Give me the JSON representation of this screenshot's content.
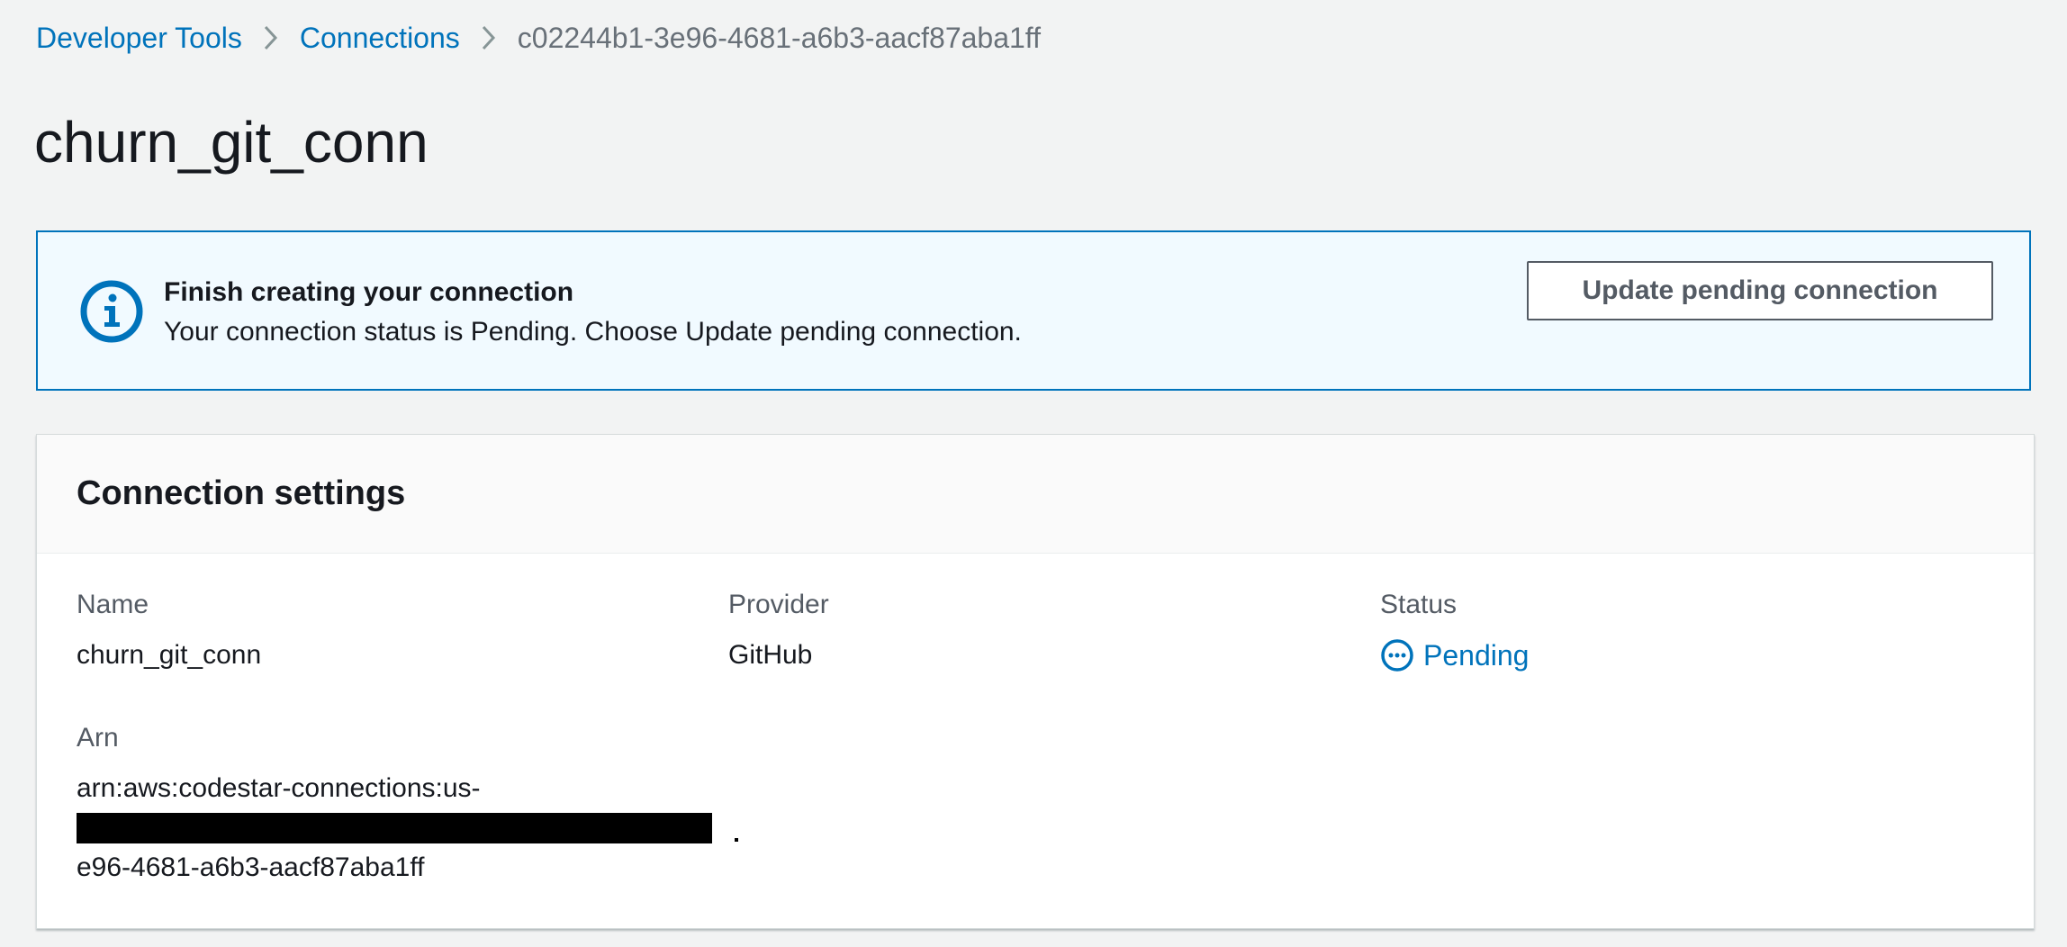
{
  "breadcrumb": {
    "items": [
      {
        "label": "Developer Tools"
      },
      {
        "label": "Connections"
      }
    ],
    "current": "c02244b1-3e96-4681-a6b3-aacf87aba1ff"
  },
  "page": {
    "title": "churn_git_conn"
  },
  "alert": {
    "icon": "info-icon",
    "title": "Finish creating your connection",
    "message": "Your connection status is Pending. Choose Update pending connection.",
    "button_label": "Update pending connection"
  },
  "settings": {
    "title": "Connection settings",
    "name_label": "Name",
    "name_value": "churn_git_conn",
    "provider_label": "Provider",
    "provider_value": "GitHub",
    "status_label": "Status",
    "status_value": "Pending",
    "status_icon": "pending-icon",
    "arn_label": "Arn",
    "arn_line1": "arn:aws:codestar-connections:us-",
    "arn_line3": "e96-4681-a6b3-aacf87aba1ff"
  },
  "colors": {
    "link": "#0073bb",
    "background": "#f2f3f3",
    "alert_background": "#f1faff",
    "text": "#16191f",
    "secondary_text": "#545b64"
  }
}
